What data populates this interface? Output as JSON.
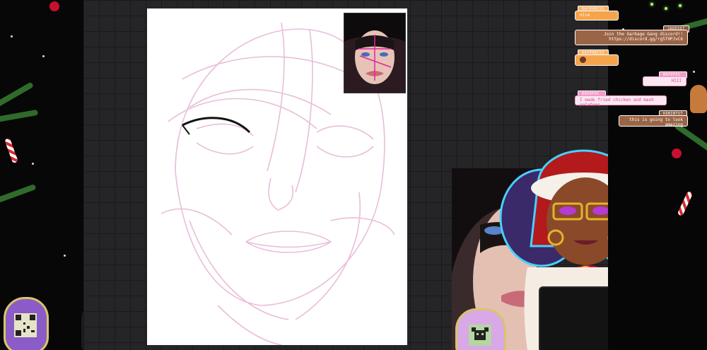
{
  "stream": {
    "chat": [
      {
        "user": "RAPPHRESS",
        "message": "nice",
        "style": "orange"
      },
      {
        "user": "JADDSO7",
        "message": "Join the Garbage Gang discord!! https://discord.gg/rg5T0PJvC6",
        "style": "brown"
      },
      {
        "user": "RAPPHRESS",
        "message": "",
        "style": "orange",
        "emote": "face-emote"
      },
      {
        "user": "BOPOPOS_",
        "message": "HIII",
        "style": "pink"
      },
      {
        "user": "BOPOPOS_",
        "message": "I made fried chicken and mash potatoes",
        "style": "pink"
      },
      {
        "user": "ROBINTUT",
        "message": "this is going to look amazing",
        "style": "brown"
      }
    ],
    "back_label": "‹",
    "colors": {
      "canvas_bg": "#ffffff",
      "grid_bg": "#252527",
      "sketch_stroke": "#e7b6d6",
      "chat_orange": "#f6a44c",
      "chat_brown": "#9a6446",
      "chat_pink": "#fbe7f1"
    }
  }
}
